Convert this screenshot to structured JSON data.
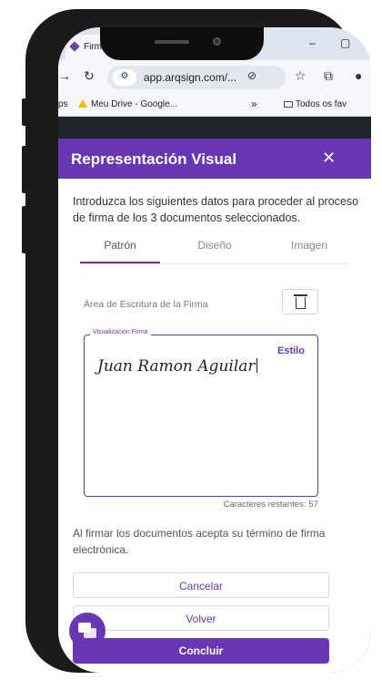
{
  "browser": {
    "tab_title": "Firma en Lot",
    "url": "app.arqsign.com/...",
    "bookmarks": [
      {
        "prefix": "ps",
        "label": "Meu Drive - Google..."
      },
      {
        "label": "»"
      },
      {
        "label": "Todos os fav"
      }
    ]
  },
  "modal": {
    "title": "Representación Visual",
    "close_glyph": "✕",
    "intro": "Introduzca los siguientes datos para proceder al proceso de firma de los 3 documentos seleccionados.",
    "tabs": [
      {
        "label": "Patrón",
        "active": true
      },
      {
        "label": "Diseño",
        "active": false
      },
      {
        "label": "Imagen",
        "active": false
      }
    ],
    "area_label": "Área de Escritura de la Firma",
    "signature": {
      "legend": "Visualización Firma",
      "style_label": "Estilo",
      "text": "Juan Ramon Aguilar",
      "chars_left_label": "Caracteres restantes:",
      "chars_left_value": "57"
    },
    "terms": "Al firmar los documentos acepta su término de firma electrónica.",
    "buttons": {
      "cancel": "Cancelar",
      "back": "Volver",
      "finish": "Concluir"
    }
  },
  "colors": {
    "accent": "#6a37b4",
    "page_bg": "#1f2228"
  },
  "icons": [
    "back-arrow-icon",
    "reload-icon",
    "site-settings-icon",
    "star-icon",
    "extensions-icon",
    "profile-icon",
    "drive-icon",
    "folder-icon",
    "trash-icon",
    "chat-icon"
  ]
}
